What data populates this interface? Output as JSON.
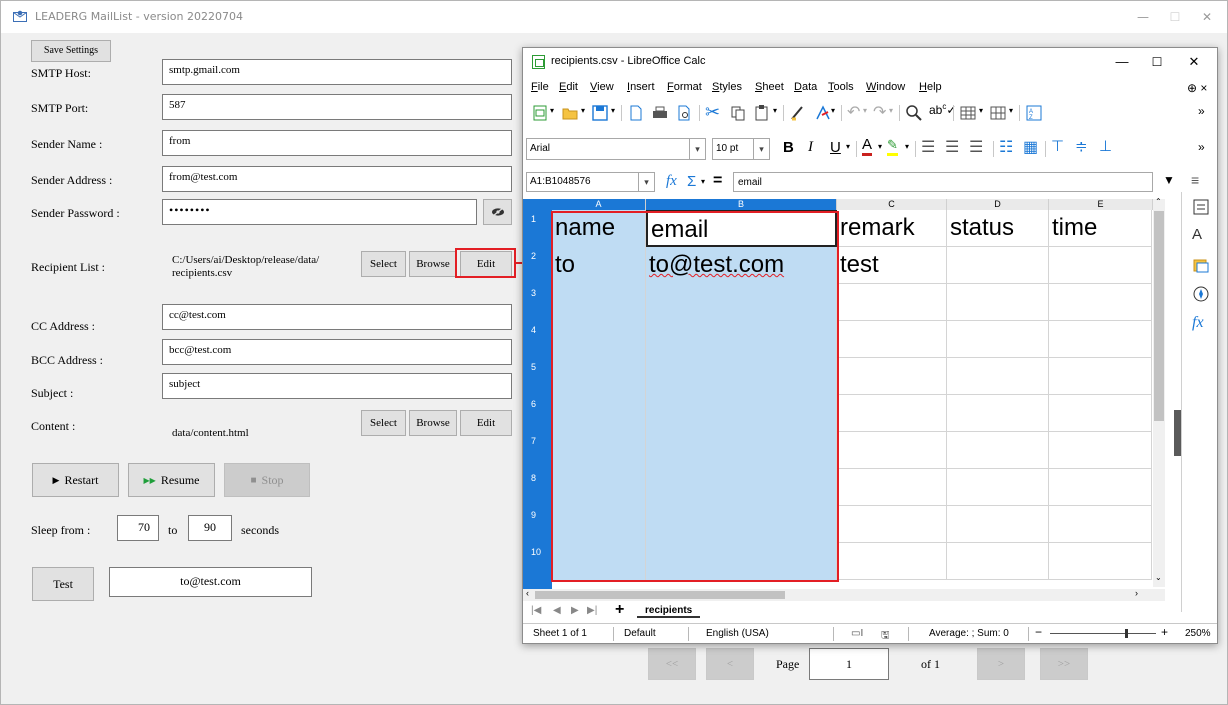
{
  "app": {
    "title": "LEADERG MailList - version 20220704",
    "window_controls": {
      "minimize": "—",
      "maximize": "☐",
      "close": "✕"
    }
  },
  "form": {
    "save_settings_label": "Save Settings",
    "smtp_host": {
      "label": "SMTP Host:",
      "value": "smtp.gmail.com"
    },
    "smtp_port": {
      "label": "SMTP Port:",
      "value": "587"
    },
    "sender_name": {
      "label": "Sender Name :",
      "value": "from"
    },
    "sender_address": {
      "label": "Sender Address :",
      "value": "from@test.com"
    },
    "sender_password": {
      "label": "Sender Password :",
      "value": "••••••••",
      "toggle_icon": "eye-slash-icon"
    },
    "recipient_list": {
      "label": "Recipient List :",
      "path_line1": "C:/Users/ai/Desktop/release/data/",
      "path_line2": "recipients.csv",
      "select_label": "Select",
      "browse_label": "Browse",
      "edit_label": "Edit"
    },
    "cc_address": {
      "label": "CC Address :",
      "value": "cc@test.com"
    },
    "bcc_address": {
      "label": "BCC Address :",
      "value": "bcc@test.com"
    },
    "subject": {
      "label": "Subject :",
      "value": "subject"
    },
    "content": {
      "label": "Content :",
      "path": "data/content.html",
      "select_label": "Select",
      "browse_label": "Browse",
      "edit_label": "Edit"
    },
    "controls": {
      "restart_label": "Restart",
      "resume_label": "Resume",
      "stop_label": "Stop"
    },
    "sleep": {
      "label": "Sleep from :",
      "from_value": "70",
      "to_label": "to",
      "to_value": "90",
      "unit_label": "seconds"
    },
    "test": {
      "button_label": "Test",
      "value": "to@test.com"
    }
  },
  "pager": {
    "first_label": "<<",
    "prev_label": "<",
    "page_label": "Page",
    "page_value": "1",
    "of_label": "of 1",
    "next_label": ">",
    "last_label": ">>"
  },
  "calc": {
    "title": "recipients.csv - LibreOffice Calc",
    "menu": [
      "File",
      "Edit",
      "View",
      "Insert",
      "Format",
      "Styles",
      "Sheet",
      "Data",
      "Tools",
      "Window",
      "Help"
    ],
    "font_name": "Arial",
    "font_size": "10 pt",
    "name_box": "A1:B1048576",
    "formula_value": "email",
    "columns": [
      "A",
      "B",
      "C",
      "D",
      "E"
    ],
    "rows": [
      {
        "num": "1",
        "cells": [
          "name",
          "email",
          "remark",
          "status",
          "time"
        ]
      },
      {
        "num": "2",
        "cells": [
          "to",
          "to@test.com",
          "test",
          "",
          ""
        ]
      },
      {
        "num": "3",
        "cells": [
          "",
          "",
          "",
          "",
          ""
        ]
      },
      {
        "num": "4",
        "cells": [
          "",
          "",
          "",
          "",
          ""
        ]
      },
      {
        "num": "5",
        "cells": [
          "",
          "",
          "",
          "",
          ""
        ]
      },
      {
        "num": "6",
        "cells": [
          "",
          "",
          "",
          "",
          ""
        ]
      },
      {
        "num": "7",
        "cells": [
          "",
          "",
          "",
          "",
          ""
        ]
      },
      {
        "num": "8",
        "cells": [
          "",
          "",
          "",
          "",
          ""
        ]
      },
      {
        "num": "9",
        "cells": [
          "",
          "",
          "",
          "",
          ""
        ]
      },
      {
        "num": "10",
        "cells": [
          "",
          "",
          "",
          "",
          ""
        ]
      }
    ],
    "sheet_tab": "recipients",
    "status": {
      "sheet": "Sheet 1 of 1",
      "style": "Default",
      "language": "English (USA)",
      "summary": "Average: ; Sum: 0",
      "zoom": "250%"
    },
    "selection_color": "#bfdcf3",
    "header_blue": "#1b78d6"
  },
  "annotation_color": "#e31e24"
}
